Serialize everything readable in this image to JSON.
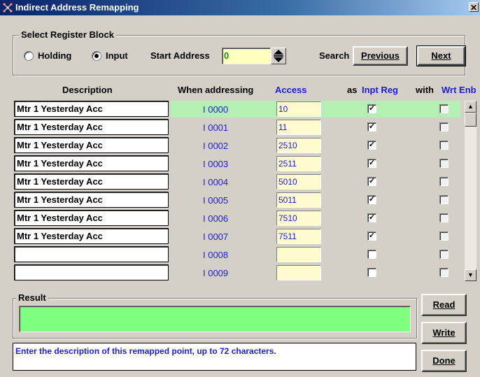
{
  "window": {
    "title": "Indirect Address Remapping",
    "close_label": "✕"
  },
  "register_block": {
    "group_label": "Select Register Block",
    "holding_label": "Holding",
    "input_label": "Input",
    "selected": "Input",
    "start_address_label": "Start Address",
    "start_address_value": "0",
    "search_label": "Search",
    "previous_label": "Previous",
    "next_label": "Next"
  },
  "columns": {
    "description": "Description",
    "when_addressing": "When addressing",
    "access": "Access",
    "as": "as",
    "inpt_reg": "Inpt Reg",
    "with": "with",
    "wrt_enb": "Wrt Enb"
  },
  "rows": [
    {
      "description": "Mtr 1 Yesterday Acc",
      "address": "I 0000",
      "access": "10",
      "inpt_reg": true,
      "wrt_enb": false,
      "selected": true
    },
    {
      "description": "Mtr 1 Yesterday Acc",
      "address": "I 0001",
      "access": "11",
      "inpt_reg": true,
      "wrt_enb": false
    },
    {
      "description": "Mtr 1 Yesterday Acc",
      "address": "I 0002",
      "access": "2510",
      "inpt_reg": true,
      "wrt_enb": false
    },
    {
      "description": "Mtr 1 Yesterday Acc",
      "address": "I 0003",
      "access": "2511",
      "inpt_reg": true,
      "wrt_enb": false
    },
    {
      "description": "Mtr 1 Yesterday Acc",
      "address": "I 0004",
      "access": "5010",
      "inpt_reg": true,
      "wrt_enb": false
    },
    {
      "description": "Mtr 1 Yesterday Acc",
      "address": "I 0005",
      "access": "5011",
      "inpt_reg": true,
      "wrt_enb": false
    },
    {
      "description": "Mtr 1 Yesterday Acc",
      "address": "I 0006",
      "access": "7510",
      "inpt_reg": true,
      "wrt_enb": false
    },
    {
      "description": "Mtr 1 Yesterday Acc",
      "address": "I 0007",
      "access": "7511",
      "inpt_reg": true,
      "wrt_enb": false
    },
    {
      "description": "",
      "address": "I 0008",
      "access": "",
      "inpt_reg": false,
      "wrt_enb": false
    },
    {
      "description": "",
      "address": "I 0009",
      "access": "",
      "inpt_reg": false,
      "wrt_enb": false
    }
  ],
  "result": {
    "label": "Result",
    "value": ""
  },
  "status_text": "Enter the description of this remapped point, up to 72 characters.",
  "buttons": {
    "read": "Read",
    "write": "Write",
    "done": "Done"
  },
  "colors": {
    "result_fill": "#80ff80",
    "access_fill": "#fffbd0",
    "selected_row": "#b4f0b4",
    "link_blue": "#1c1cd4",
    "start_addr_fill": "#ffffc0"
  },
  "icons": {
    "app": "network-icon",
    "spin": "spin-updown-icon",
    "scroll_up": "arrow-up-icon",
    "scroll_down": "arrow-down-icon"
  }
}
